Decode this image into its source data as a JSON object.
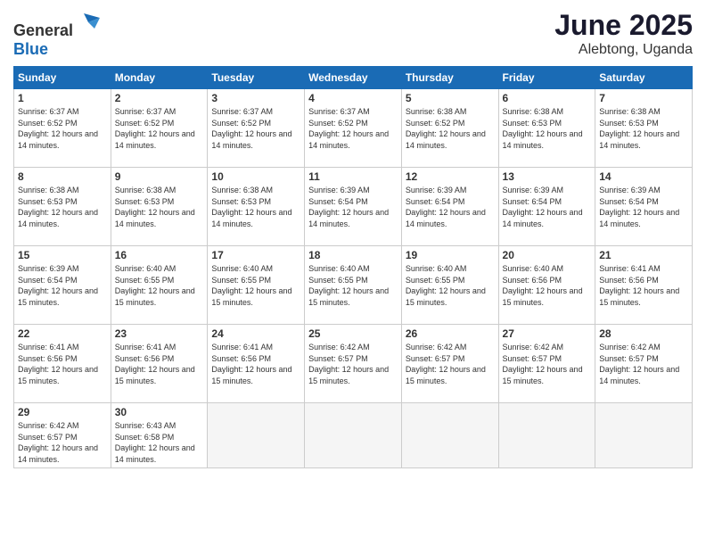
{
  "header": {
    "logo_general": "General",
    "logo_blue": "Blue",
    "month": "June 2025",
    "location": "Alebtong, Uganda"
  },
  "days_of_week": [
    "Sunday",
    "Monday",
    "Tuesday",
    "Wednesday",
    "Thursday",
    "Friday",
    "Saturday"
  ],
  "weeks": [
    [
      {
        "day": "1",
        "sunrise": "Sunrise: 6:37 AM",
        "sunset": "Sunset: 6:52 PM",
        "daylight": "Daylight: 12 hours and 14 minutes."
      },
      {
        "day": "2",
        "sunrise": "Sunrise: 6:37 AM",
        "sunset": "Sunset: 6:52 PM",
        "daylight": "Daylight: 12 hours and 14 minutes."
      },
      {
        "day": "3",
        "sunrise": "Sunrise: 6:37 AM",
        "sunset": "Sunset: 6:52 PM",
        "daylight": "Daylight: 12 hours and 14 minutes."
      },
      {
        "day": "4",
        "sunrise": "Sunrise: 6:37 AM",
        "sunset": "Sunset: 6:52 PM",
        "daylight": "Daylight: 12 hours and 14 minutes."
      },
      {
        "day": "5",
        "sunrise": "Sunrise: 6:38 AM",
        "sunset": "Sunset: 6:52 PM",
        "daylight": "Daylight: 12 hours and 14 minutes."
      },
      {
        "day": "6",
        "sunrise": "Sunrise: 6:38 AM",
        "sunset": "Sunset: 6:53 PM",
        "daylight": "Daylight: 12 hours and 14 minutes."
      },
      {
        "day": "7",
        "sunrise": "Sunrise: 6:38 AM",
        "sunset": "Sunset: 6:53 PM",
        "daylight": "Daylight: 12 hours and 14 minutes."
      }
    ],
    [
      {
        "day": "8",
        "sunrise": "Sunrise: 6:38 AM",
        "sunset": "Sunset: 6:53 PM",
        "daylight": "Daylight: 12 hours and 14 minutes."
      },
      {
        "day": "9",
        "sunrise": "Sunrise: 6:38 AM",
        "sunset": "Sunset: 6:53 PM",
        "daylight": "Daylight: 12 hours and 14 minutes."
      },
      {
        "day": "10",
        "sunrise": "Sunrise: 6:38 AM",
        "sunset": "Sunset: 6:53 PM",
        "daylight": "Daylight: 12 hours and 14 minutes."
      },
      {
        "day": "11",
        "sunrise": "Sunrise: 6:39 AM",
        "sunset": "Sunset: 6:54 PM",
        "daylight": "Daylight: 12 hours and 14 minutes."
      },
      {
        "day": "12",
        "sunrise": "Sunrise: 6:39 AM",
        "sunset": "Sunset: 6:54 PM",
        "daylight": "Daylight: 12 hours and 14 minutes."
      },
      {
        "day": "13",
        "sunrise": "Sunrise: 6:39 AM",
        "sunset": "Sunset: 6:54 PM",
        "daylight": "Daylight: 12 hours and 14 minutes."
      },
      {
        "day": "14",
        "sunrise": "Sunrise: 6:39 AM",
        "sunset": "Sunset: 6:54 PM",
        "daylight": "Daylight: 12 hours and 14 minutes."
      }
    ],
    [
      {
        "day": "15",
        "sunrise": "Sunrise: 6:39 AM",
        "sunset": "Sunset: 6:54 PM",
        "daylight": "Daylight: 12 hours and 15 minutes."
      },
      {
        "day": "16",
        "sunrise": "Sunrise: 6:40 AM",
        "sunset": "Sunset: 6:55 PM",
        "daylight": "Daylight: 12 hours and 15 minutes."
      },
      {
        "day": "17",
        "sunrise": "Sunrise: 6:40 AM",
        "sunset": "Sunset: 6:55 PM",
        "daylight": "Daylight: 12 hours and 15 minutes."
      },
      {
        "day": "18",
        "sunrise": "Sunrise: 6:40 AM",
        "sunset": "Sunset: 6:55 PM",
        "daylight": "Daylight: 12 hours and 15 minutes."
      },
      {
        "day": "19",
        "sunrise": "Sunrise: 6:40 AM",
        "sunset": "Sunset: 6:55 PM",
        "daylight": "Daylight: 12 hours and 15 minutes."
      },
      {
        "day": "20",
        "sunrise": "Sunrise: 6:40 AM",
        "sunset": "Sunset: 6:56 PM",
        "daylight": "Daylight: 12 hours and 15 minutes."
      },
      {
        "day": "21",
        "sunrise": "Sunrise: 6:41 AM",
        "sunset": "Sunset: 6:56 PM",
        "daylight": "Daylight: 12 hours and 15 minutes."
      }
    ],
    [
      {
        "day": "22",
        "sunrise": "Sunrise: 6:41 AM",
        "sunset": "Sunset: 6:56 PM",
        "daylight": "Daylight: 12 hours and 15 minutes."
      },
      {
        "day": "23",
        "sunrise": "Sunrise: 6:41 AM",
        "sunset": "Sunset: 6:56 PM",
        "daylight": "Daylight: 12 hours and 15 minutes."
      },
      {
        "day": "24",
        "sunrise": "Sunrise: 6:41 AM",
        "sunset": "Sunset: 6:56 PM",
        "daylight": "Daylight: 12 hours and 15 minutes."
      },
      {
        "day": "25",
        "sunrise": "Sunrise: 6:42 AM",
        "sunset": "Sunset: 6:57 PM",
        "daylight": "Daylight: 12 hours and 15 minutes."
      },
      {
        "day": "26",
        "sunrise": "Sunrise: 6:42 AM",
        "sunset": "Sunset: 6:57 PM",
        "daylight": "Daylight: 12 hours and 15 minutes."
      },
      {
        "day": "27",
        "sunrise": "Sunrise: 6:42 AM",
        "sunset": "Sunset: 6:57 PM",
        "daylight": "Daylight: 12 hours and 15 minutes."
      },
      {
        "day": "28",
        "sunrise": "Sunrise: 6:42 AM",
        "sunset": "Sunset: 6:57 PM",
        "daylight": "Daylight: 12 hours and 14 minutes."
      }
    ],
    [
      {
        "day": "29",
        "sunrise": "Sunrise: 6:42 AM",
        "sunset": "Sunset: 6:57 PM",
        "daylight": "Daylight: 12 hours and 14 minutes."
      },
      {
        "day": "30",
        "sunrise": "Sunrise: 6:43 AM",
        "sunset": "Sunset: 6:58 PM",
        "daylight": "Daylight: 12 hours and 14 minutes."
      },
      null,
      null,
      null,
      null,
      null
    ]
  ]
}
